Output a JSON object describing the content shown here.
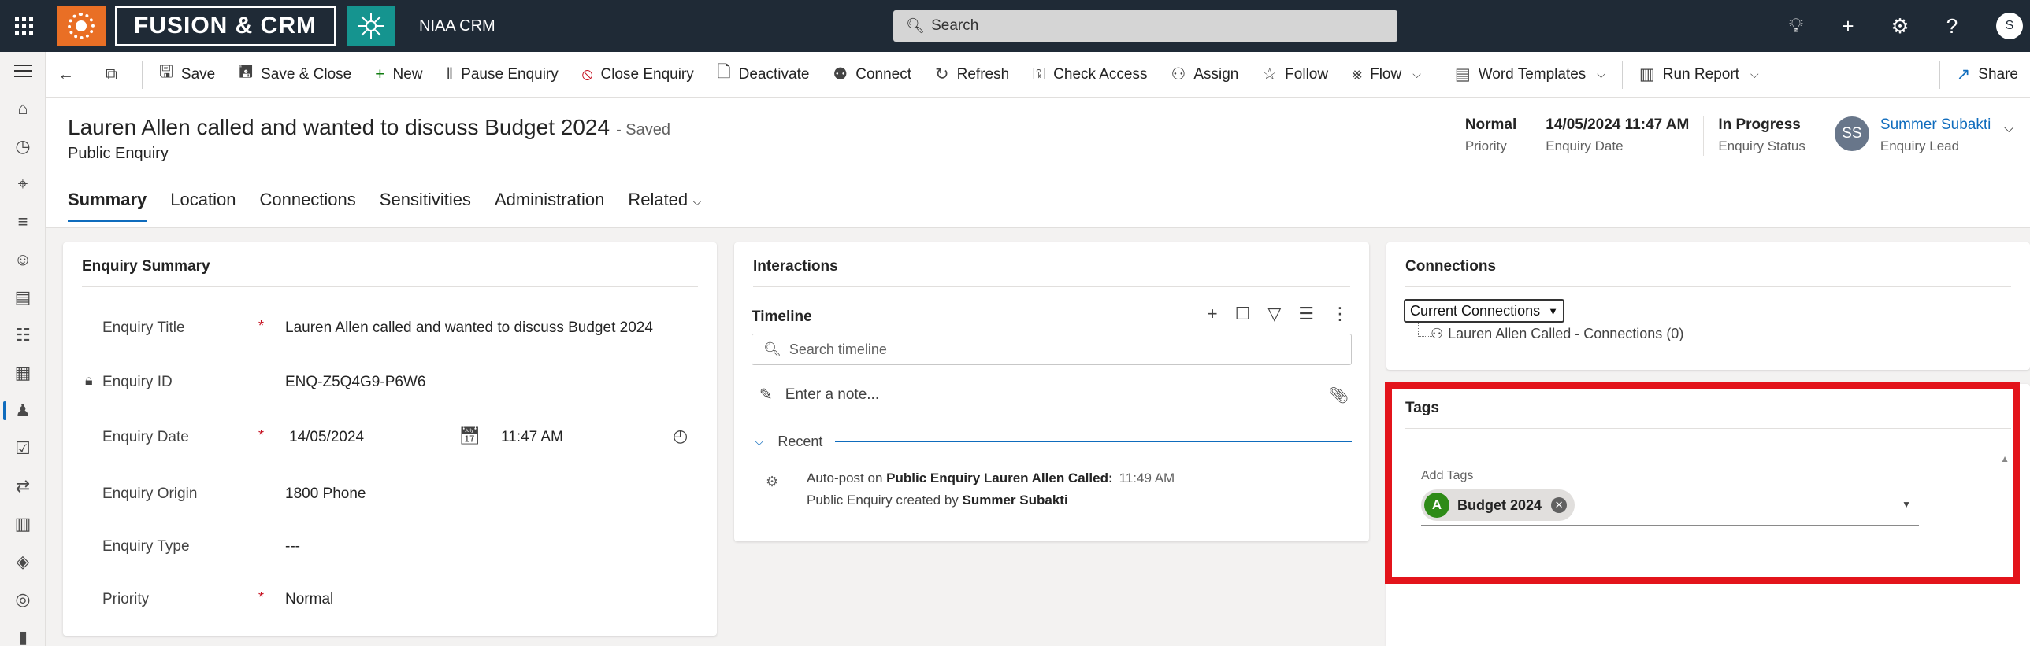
{
  "app": {
    "brand_name": "FUSION & CRM",
    "app_name": "NIAA CRM",
    "search_placeholder": "Search",
    "top_icons": [
      "lightbulb-icon",
      "plus-icon",
      "gear-icon",
      "help-icon"
    ],
    "user_initial": "S"
  },
  "left_rail": [
    "home-icon",
    "recent-icon",
    "pinned-icon",
    "activities-icon",
    "contacts-icon",
    "notebook-icon",
    "org-icon",
    "reports-icon",
    "enquiry-icon",
    "clipboard-icon",
    "connections-icon",
    "book-icon",
    "layers-icon",
    "lightbulb-icon",
    "device-icon"
  ],
  "command_bar": {
    "save": "Save",
    "save_close": "Save & Close",
    "new": "New",
    "pause_enquiry": "Pause Enquiry",
    "close_enquiry": "Close Enquiry",
    "deactivate": "Deactivate",
    "connect": "Connect",
    "refresh": "Refresh",
    "check_access": "Check Access",
    "assign": "Assign",
    "follow": "Follow",
    "flow": "Flow",
    "word_templates": "Word Templates",
    "run_report": "Run Report",
    "share": "Share"
  },
  "record": {
    "title": "Lauren Allen called and wanted to discuss Budget 2024",
    "saved_state": "- Saved",
    "entity": "Public Enquiry",
    "header_fields": [
      {
        "value": "Normal",
        "label": "Priority"
      },
      {
        "value": "14/05/2024 11:47 AM",
        "label": "Enquiry Date"
      },
      {
        "value": "In Progress",
        "label": "Enquiry Status"
      }
    ],
    "owner": {
      "initials": "SS",
      "name": "Summer Subakti",
      "label": "Enquiry Lead"
    }
  },
  "tabs": [
    "Summary",
    "Location",
    "Connections",
    "Sensitivities",
    "Administration",
    "Related"
  ],
  "summary": {
    "heading": "Enquiry Summary",
    "fields": {
      "title": {
        "label": "Enquiry Title",
        "value": "Lauren Allen called and wanted to discuss Budget 2024"
      },
      "id": {
        "label": "Enquiry ID",
        "value": "ENQ-Z5Q4G9-P6W6"
      },
      "date": {
        "label": "Enquiry Date",
        "value": "14/05/2024",
        "time": "11:47 AM"
      },
      "origin": {
        "label": "Enquiry Origin",
        "value": "1800 Phone"
      },
      "type": {
        "label": "Enquiry Type",
        "value": "---"
      },
      "priority": {
        "label": "Priority",
        "value": "Normal"
      }
    },
    "required_mark": "*"
  },
  "interactions": {
    "heading": "Interactions",
    "timeline_label": "Timeline",
    "search_placeholder": "Search timeline",
    "note_placeholder": "Enter a note...",
    "recent_label": "Recent",
    "post": {
      "prefix": "Auto-post on",
      "subject": "Public Enquiry Lauren Allen Called:",
      "time": "11:49 AM",
      "line2_prefix": "Public Enquiry created by",
      "line2_author": "Summer Subakti"
    }
  },
  "connections": {
    "heading": "Connections",
    "view_selected": "Current Connections",
    "item": "Lauren Allen Called - Connections (0)"
  },
  "tags": {
    "heading": "Tags",
    "field_label": "Add Tags",
    "items": [
      {
        "initial": "A",
        "label": "Budget 2024"
      }
    ]
  },
  "colors": {
    "topbar": "#1f2a36",
    "brand_orange": "#e96f25",
    "brand_teal": "#15948f",
    "accent_blue": "#0f6cbd",
    "highlight_red": "#e3141b",
    "tag_green": "#2e8b17"
  }
}
